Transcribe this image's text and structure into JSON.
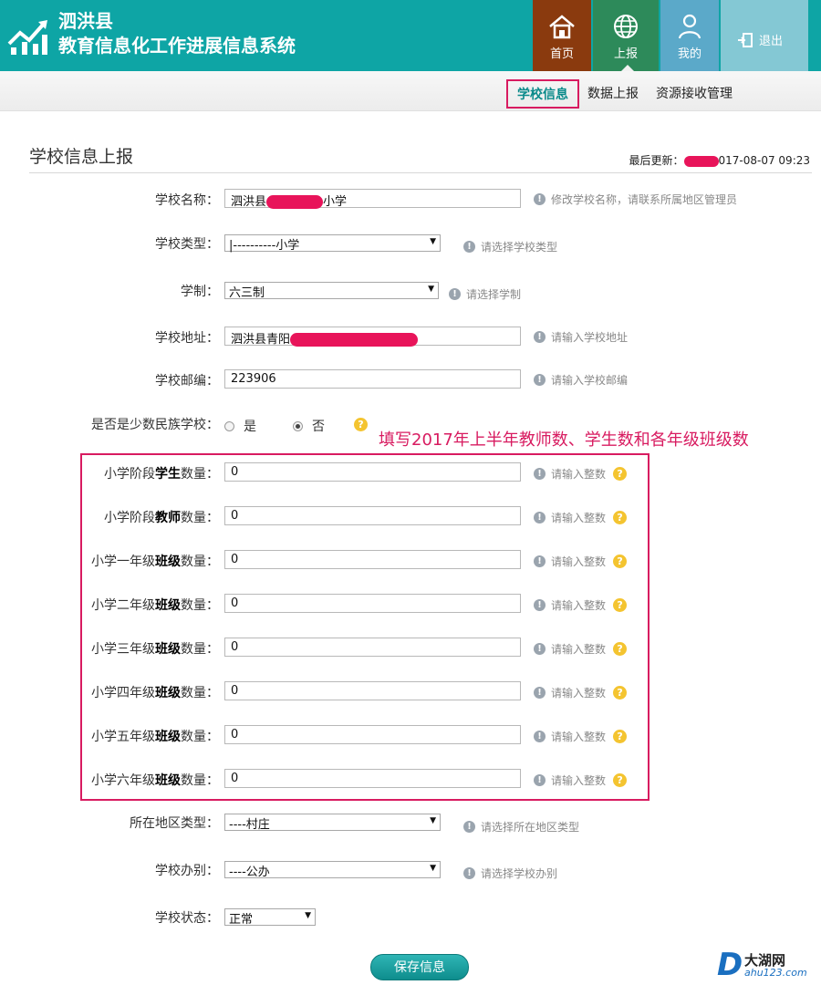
{
  "header": {
    "title_line1": "泗洪县",
    "title_line2": "教育信息化工作进展信息系统",
    "nav": {
      "home": "首页",
      "report": "上报",
      "mine": "我的",
      "exit": "退出"
    }
  },
  "subnav": {
    "school_info": "学校信息",
    "data_report": "数据上报",
    "resource_mgmt": "资源接收管理"
  },
  "page": {
    "title": "学校信息上报",
    "last_update_label": "最后更新：",
    "last_update_value": "017-08-07 09:23"
  },
  "form": {
    "school_name": {
      "label": "学校名称：",
      "value_prefix": "泗洪县",
      "value_suffix": "小学",
      "hint": "修改学校名称，请联系所属地区管理员"
    },
    "school_type": {
      "label": "学校类型：",
      "value": "|----------小学",
      "hint": "请选择学校类型"
    },
    "school_system": {
      "label": "学制：",
      "value": "六三制",
      "hint": "请选择学制"
    },
    "school_address": {
      "label": "学校地址：",
      "value_prefix": "泗洪县青阳",
      "hint": "请输入学校地址"
    },
    "school_zip": {
      "label": "学校邮编：",
      "value": "223906",
      "hint": "请输入学校邮编"
    },
    "ethnic_school": {
      "label": "是否是少数民族学校：",
      "option_yes": "是",
      "option_no": "否",
      "selected": "否"
    },
    "annotation": "填写2017年上半年教师数、学生数和各年级班级数",
    "counts": {
      "hint": "请输入整数",
      "suffix": "数量：",
      "rows": [
        {
          "pre": "小学阶段",
          "bold": "学生",
          "value": "0"
        },
        {
          "pre": "小学阶段",
          "bold": "教师",
          "value": "0"
        },
        {
          "pre": "小学一年级",
          "bold": "班级",
          "value": "0"
        },
        {
          "pre": "小学二年级",
          "bold": "班级",
          "value": "0"
        },
        {
          "pre": "小学三年级",
          "bold": "班级",
          "value": "0"
        },
        {
          "pre": "小学四年级",
          "bold": "班级",
          "value": "0"
        },
        {
          "pre": "小学五年级",
          "bold": "班级",
          "value": "0"
        },
        {
          "pre": "小学六年级",
          "bold": "班级",
          "value": "0"
        }
      ]
    },
    "region_type": {
      "label": "所在地区类型：",
      "value": "----村庄",
      "hint": "请选择所在地区类型"
    },
    "school_operation": {
      "label": "学校办别：",
      "value": "----公办",
      "hint": "请选择学校办别"
    },
    "school_status": {
      "label": "学校状态：",
      "value": "正常"
    },
    "save": "保存信息"
  },
  "watermark": {
    "brand": "大湖网",
    "url": "ahu123.com",
    "letter": "D"
  },
  "colors": {
    "header_teal": "#0ea5a5",
    "home_brown": "#8a3a0e",
    "report_green": "#2d8a5a",
    "mine_blue": "#5ba9c9",
    "exit_light": "#84c8d4",
    "annotation_pink": "#d81b60"
  }
}
